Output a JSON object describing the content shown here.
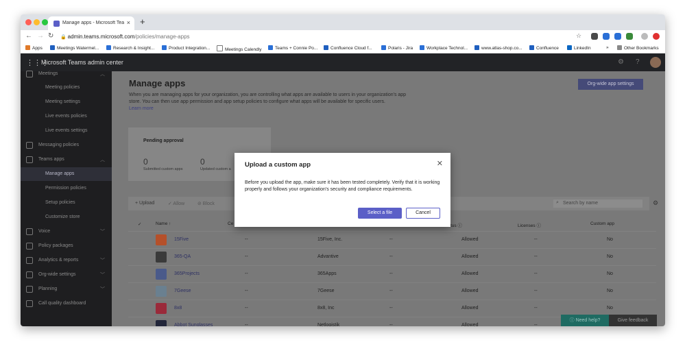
{
  "browser": {
    "tab_title": "Manage apps - Microsoft Teams",
    "tab_close": "×",
    "new_tab": "+",
    "url_host": "admin.teams.microsoft.com",
    "url_path": "/policies/manage-apps",
    "bookmarks": [
      "Apps",
      "Meetings Watermel...",
      "Research & Insight...",
      "Product Integration...",
      "Meetings Calendly",
      "Teams + Connie Po...",
      "Confluence Cloud f...",
      "Polaris - Jira",
      "Workplace Technol...",
      "www.atlas-shop.co...",
      "Confluence",
      "LinkedIn",
      "»",
      "Other Bookmarks"
    ]
  },
  "header": {
    "app_title": "Microsoft Teams admin center"
  },
  "sidebar": {
    "items": [
      {
        "label": "Meetings"
      },
      {
        "label": "Meeting policies"
      },
      {
        "label": "Meeting settings"
      },
      {
        "label": "Live events policies"
      },
      {
        "label": "Live events settings"
      },
      {
        "label": "Messaging policies"
      },
      {
        "label": "Teams apps"
      },
      {
        "label": "Manage apps"
      },
      {
        "label": "Permission policies"
      },
      {
        "label": "Setup policies"
      },
      {
        "label": "Customize store"
      },
      {
        "label": "Voice"
      },
      {
        "label": "Policy packages"
      },
      {
        "label": "Analytics & reports"
      },
      {
        "label": "Org-wide settings"
      },
      {
        "label": "Planning"
      },
      {
        "label": "Call quality dashboard"
      }
    ]
  },
  "main": {
    "title": "Manage apps",
    "description": "When you are managing apps for your organization, you are controlling what apps are available to users in your organization's app store. You can then use app permission and app setup policies to configure what apps will be available for specific users.",
    "learn_more": "Learn more",
    "org_wide_button": "Org-wide app settings",
    "pending": {
      "title": "Pending approval",
      "submitted_value": "0",
      "submitted_label": "Submitted custom apps",
      "updated_value": "0",
      "updated_label": "Updated custom a"
    },
    "toolbar": {
      "upload": "+ Upload",
      "allow": "✓ Allow",
      "block": "⊘ Block",
      "search_placeholder": "Search by name"
    },
    "columns": {
      "name": "Name ↑",
      "cert": "Ce",
      "status": "tus",
      "licenses": "Licenses",
      "custom_app": "Custom app"
    },
    "rows": [
      {
        "name": "15Five",
        "cert": "--",
        "publisher": "15Five, Inc.",
        "col4": "--",
        "status": "Allowed",
        "licenses": "--",
        "custom": "No",
        "color": "#b5502a"
      },
      {
        "name": "365-QA",
        "cert": "--",
        "publisher": "Advantive",
        "col4": "--",
        "status": "Allowed",
        "licenses": "--",
        "custom": "No",
        "color": "#3a3a3a"
      },
      {
        "name": "365Projects",
        "cert": "--",
        "publisher": "365Apps",
        "col4": "--",
        "status": "Allowed",
        "licenses": "--",
        "custom": "No",
        "color": "#4a5a8a"
      },
      {
        "name": "7Geese",
        "cert": "--",
        "publisher": "7Geese",
        "col4": "--",
        "status": "Allowed",
        "licenses": "--",
        "custom": "No",
        "color": "#6a8090"
      },
      {
        "name": "8x8",
        "cert": "--",
        "publisher": "8x8, Inc",
        "col4": "--",
        "status": "Allowed",
        "licenses": "--",
        "custom": "No",
        "color": "#9a2a3a"
      },
      {
        "name": "Abbot Sunglasses",
        "cert": "--",
        "publisher": "Netlogistik",
        "col4": "--",
        "status": "Allowed",
        "licenses": "--",
        "custom": "No",
        "color": "#22263a"
      }
    ]
  },
  "help": {
    "need_help": "Need help?",
    "give_feedback": "Give feedback"
  },
  "dialog": {
    "title": "Upload a custom app",
    "close": "✕",
    "body": "Before you upload the app, make sure it has been tested completely. Verify that it is working properly and follows your organization's security and compliance requirements.",
    "primary": "Select a file",
    "secondary": "Cancel"
  },
  "colors": {
    "accent": "#5b5fc7",
    "header_bg": "#222326",
    "sidebar_bg": "#1e1e20",
    "overlay": "#797979"
  }
}
